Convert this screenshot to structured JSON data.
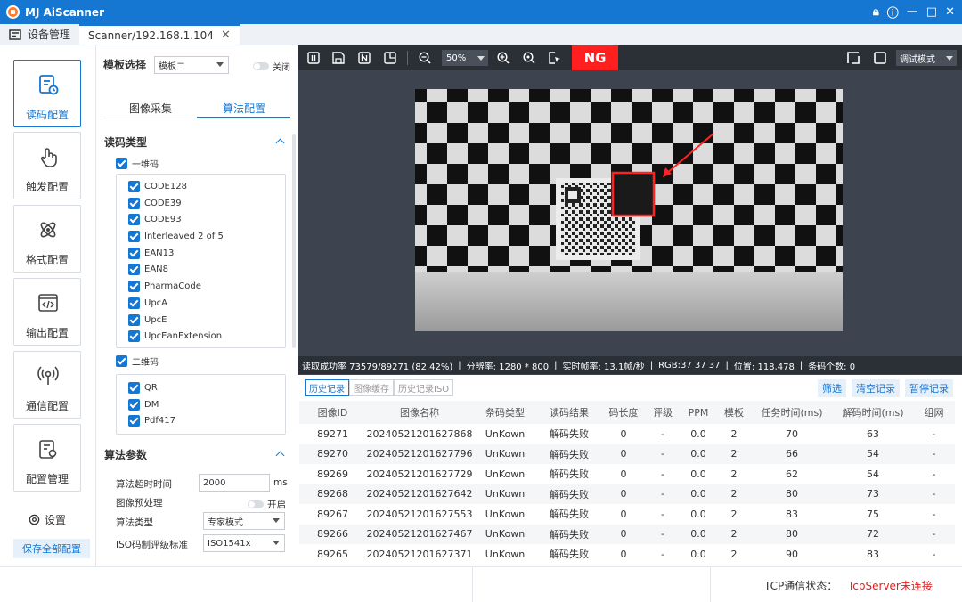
{
  "titlebar": {
    "app_title": "MJ AiScanner"
  },
  "tabs": [
    {
      "label": "设备管理"
    },
    {
      "label": "Scanner/192.168.1.104"
    }
  ],
  "nav": {
    "items": [
      {
        "label": "读码配置",
        "active": true
      },
      {
        "label": "触发配置"
      },
      {
        "label": "格式配置"
      },
      {
        "label": "输出配置"
      },
      {
        "label": "通信配置"
      },
      {
        "label": "配置管理"
      }
    ],
    "settings_label": "设置",
    "save_all_label": "保存全部配置"
  },
  "config": {
    "template_label": "模板选择",
    "template_value": "模板二",
    "template_toggle_label": "关闭",
    "subtabs": {
      "capture": "图像采集",
      "algorithm": "算法配置",
      "active": "algorithm"
    },
    "read_type_title": "读码类型",
    "oned_label": "一维码",
    "oned_codes": [
      "CODE128",
      "CODE39",
      "CODE93",
      "Interleaved 2 of 5",
      "EAN13",
      "EAN8",
      "PharmaCode",
      "UpcA",
      "UpcE",
      "UpcEanExtension"
    ],
    "twod_label": "二维码",
    "twod_codes": [
      "QR",
      "DM",
      "Pdf417"
    ],
    "algo_params_title": "算法参数",
    "timeout_label": "算法超时时间",
    "timeout_value": "2000",
    "timeout_unit": "ms",
    "preprocess_label": "图像预处理",
    "preprocess_toggle_label": "开启",
    "algo_type_label": "算法类型",
    "algo_type_value": "专家模式",
    "iso_label": "ISO码制评级标准",
    "iso_value": "ISO1541x"
  },
  "viewer": {
    "zoom_value": "50%",
    "ng_label": "NG",
    "mode_value": "调试模式",
    "status": {
      "success_rate": "读取成功率 73579/89271 (82.42%)",
      "resolution": "分辨率: 1280 * 800",
      "fps": "实时帧率: 13.1帧/秒",
      "rgb": "RGB:37 37 37",
      "position": "位置: 118,478",
      "barcode_count": "条码个数: 0"
    }
  },
  "history": {
    "tabs": [
      "历史记录",
      "图像缓存",
      "历史记录ISO"
    ],
    "buttons": {
      "filter": "筛选",
      "clear": "清空记录",
      "pause": "暂停记录"
    },
    "columns": [
      "图像ID",
      "图像名称",
      "条码类型",
      "读码结果",
      "码长度",
      "评级",
      "PPM",
      "模板",
      "任务时间(ms)",
      "解码时间(ms)",
      "组网"
    ],
    "rows": [
      [
        "89271",
        "20240521201627868",
        "UnKown",
        "解码失败",
        "0",
        "-",
        "0.0",
        "2",
        "70",
        "63",
        "-"
      ],
      [
        "89270",
        "20240521201627796",
        "UnKown",
        "解码失败",
        "0",
        "-",
        "0.0",
        "2",
        "66",
        "54",
        "-"
      ],
      [
        "89269",
        "20240521201627729",
        "UnKown",
        "解码失败",
        "0",
        "-",
        "0.0",
        "2",
        "62",
        "54",
        "-"
      ],
      [
        "89268",
        "20240521201627642",
        "UnKown",
        "解码失败",
        "0",
        "-",
        "0.0",
        "2",
        "80",
        "73",
        "-"
      ],
      [
        "89267",
        "20240521201627553",
        "UnKown",
        "解码失败",
        "0",
        "-",
        "0.0",
        "2",
        "83",
        "75",
        "-"
      ],
      [
        "89266",
        "20240521201627467",
        "UnKown",
        "解码失败",
        "0",
        "-",
        "0.0",
        "2",
        "80",
        "72",
        "-"
      ],
      [
        "89265",
        "20240521201627371",
        "UnKown",
        "解码失败",
        "0",
        "-",
        "0.0",
        "2",
        "90",
        "83",
        "-"
      ]
    ]
  },
  "footer": {
    "tcp_label": "TCP通信状态：",
    "tcp_status": "TcpServer未连接"
  },
  "colors": {
    "accent": "#1677d2",
    "ng": "#ff1f1f",
    "error_text": "#e02020"
  }
}
